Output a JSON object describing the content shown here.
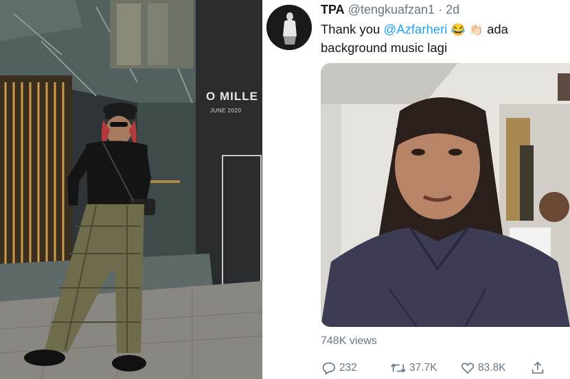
{
  "left_photo": {
    "store_sign": "O MILLE",
    "store_date": "JUNE 2020"
  },
  "tweet": {
    "display_name": "TPA",
    "handle": "@tengkuafzan1",
    "separator": "·",
    "age": "2d",
    "text_before": "Thank you ",
    "mention": "@Azfarheri",
    "emoji_1": "😂",
    "emoji_2": "👏🏻",
    "text_after": " ada background music lagi",
    "views": "748K views",
    "replies": "232",
    "retweets": "37.7K",
    "likes": "83.8K"
  },
  "colors": {
    "accent": "#1da1f2",
    "secondary_text": "#657786",
    "primary_text": "#14171a"
  },
  "icons": [
    "reply-icon",
    "retweet-icon",
    "like-icon",
    "share-icon"
  ]
}
